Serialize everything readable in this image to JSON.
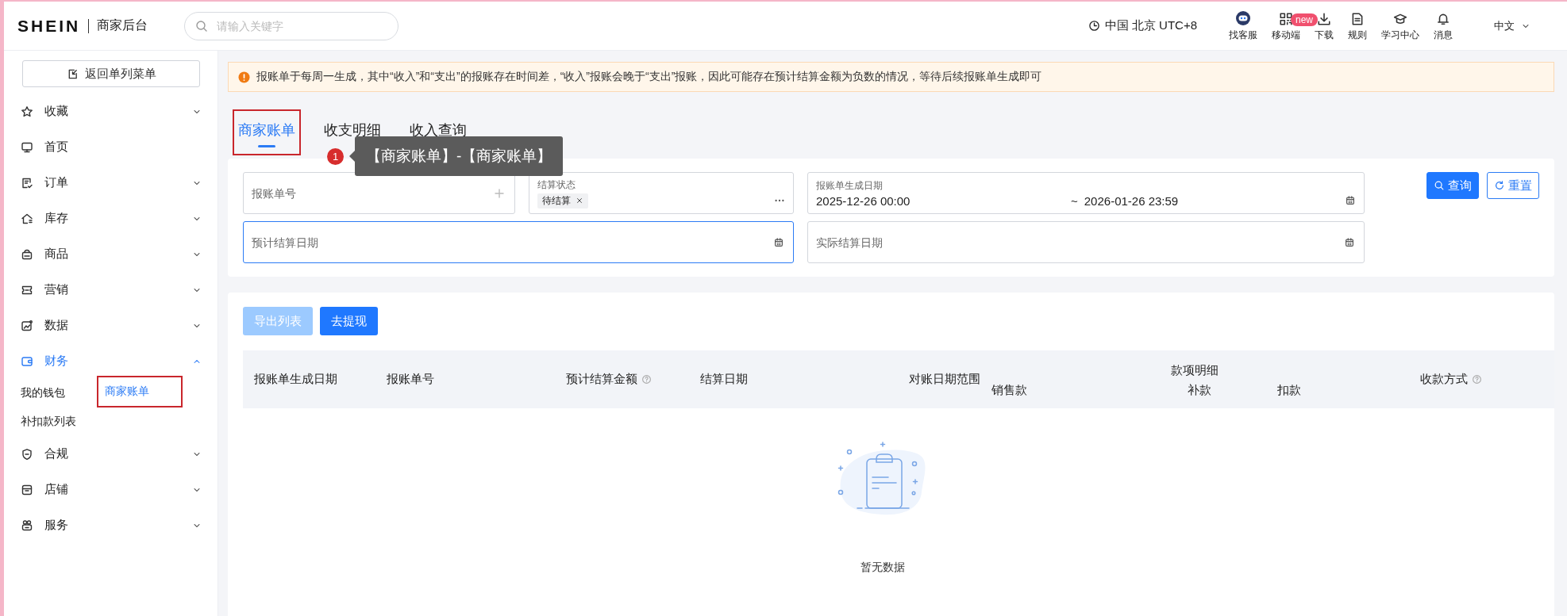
{
  "header": {
    "logo": "SHEIN",
    "product": "商家后台",
    "search": {
      "placeholder": "请输入关键字"
    },
    "timezone": "中国 北京 UTC+8",
    "tools": [
      {
        "label": "找客服",
        "kind": "bot"
      },
      {
        "label": "移动端",
        "kind": "grid",
        "badge": "new"
      },
      {
        "label": "下载",
        "kind": "download"
      },
      {
        "label": "规则",
        "kind": "doc"
      },
      {
        "label": "学习中心",
        "kind": "cap"
      },
      {
        "label": "消息",
        "kind": "bell"
      }
    ],
    "language": "中文"
  },
  "sidebar": {
    "back_button": "返回单列菜单",
    "items": [
      {
        "label": "收藏",
        "kind": "group",
        "expanded": false,
        "selected": false
      },
      {
        "label": "首页",
        "kind": "link",
        "selected": false
      },
      {
        "label": "订单",
        "kind": "group",
        "expanded": false,
        "selected": false
      },
      {
        "label": "库存",
        "kind": "group",
        "expanded": false,
        "selected": false
      },
      {
        "label": "商品",
        "kind": "group",
        "expanded": false,
        "selected": false
      },
      {
        "label": "营销",
        "kind": "group",
        "expanded": false,
        "selected": false
      },
      {
        "label": "数据",
        "kind": "group",
        "expanded": false,
        "selected": false
      },
      {
        "label": "财务",
        "kind": "group",
        "expanded": true,
        "selected": true,
        "children": [
          {
            "label": "我的钱包",
            "selected": false,
            "highlighted": false
          },
          {
            "label": "商家账单",
            "selected": true,
            "highlighted": true
          },
          {
            "label": "补扣款列表",
            "selected": false,
            "highlighted": false
          }
        ]
      },
      {
        "label": "合规",
        "kind": "group",
        "expanded": false,
        "selected": false
      },
      {
        "label": "店铺",
        "kind": "group",
        "expanded": false,
        "selected": false
      },
      {
        "label": "服务",
        "kind": "group",
        "expanded": false,
        "selected": false
      }
    ]
  },
  "alert": {
    "text": "报账单于每周一生成，其中“收入”和“支出”的报账存在时间差，“收入”报账会晚于“支出”报账，因此可能存在预计结算金额为负数的情况，等待后续报账单生成即可"
  },
  "tabs": [
    {
      "label": "商家账单",
      "selected": true,
      "highlighted": true
    },
    {
      "label": "收支明细",
      "selected": false,
      "highlighted": false
    },
    {
      "label": "收入查询",
      "selected": false,
      "highlighted": false
    }
  ],
  "annotation": {
    "number": "1",
    "text": "【商家账单】-【商家账单】"
  },
  "filters": {
    "fields": [
      {
        "kind": "text",
        "placeholder": "报账单号",
        "focused": false
      },
      {
        "kind": "select",
        "label": "结算状态",
        "tags": [
          "待结算"
        ],
        "focused": false
      },
      {
        "kind": "range",
        "label": "报账单生成日期",
        "start": "2025-12-26 00:00",
        "separator": "~",
        "end": "2026-01-26 23:59",
        "focused": false
      },
      {
        "kind": "date",
        "placeholder": "预计结算日期",
        "focused": true
      },
      {
        "kind": "date",
        "placeholder": "实际结算日期",
        "focused": false
      }
    ],
    "search_button": "查询",
    "reset_button": "重置"
  },
  "actions": [
    {
      "label": "导出列表",
      "disabled": true
    },
    {
      "label": "去提现",
      "disabled": false
    }
  ],
  "table": {
    "columns": [
      {
        "label": "报账单生成日期"
      },
      {
        "label": "报账单号"
      },
      {
        "label": "预计结算金额",
        "help": true
      },
      {
        "label": "结算日期"
      },
      {
        "label": "对账日期范围"
      },
      {
        "label": "款项明细",
        "children": [
          {
            "label": "销售款"
          },
          {
            "label": "补款"
          },
          {
            "label": "扣款"
          }
        ]
      },
      {
        "label": "收款方式",
        "help": true
      }
    ],
    "empty_text": "暂无数据"
  }
}
